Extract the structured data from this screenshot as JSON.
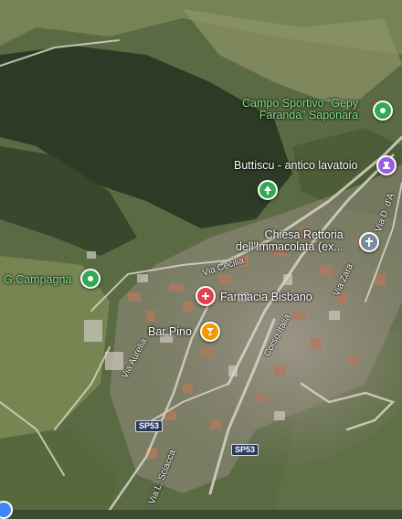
{
  "map": {
    "pois": {
      "campo_sportivo": {
        "line1": "Campo Sportivo “Gepy",
        "line2": "Faranda” Saponara"
      },
      "buttiscu": {
        "label": "Buttiscu - antico lavatoio"
      },
      "chiesa": {
        "line1": "Chiesa Rettoria",
        "line2": "dell'Immacolata (ex..."
      },
      "g_campagna": {
        "label": "G.Campagna"
      },
      "farmacia": {
        "label": "Farmacia Bisbano"
      },
      "bar_pino": {
        "label": "Bar Pino"
      }
    },
    "roads": {
      "via_cecilia": "Via Cecilia",
      "corso_italia": "Corso Italia",
      "via_zara": "Via Zara",
      "via_d_da": "Via D. d'A",
      "via_aurelia": "Via Aurelia",
      "via_l_sciacca": "Via L. Sciacca"
    },
    "shields": {
      "sp53_a": "SP53",
      "sp53_b": "SP53"
    },
    "colors": {
      "park_green": "#34a853",
      "pharmacy_red": "#e0424b",
      "bar_orange": "#f29900",
      "museum_purple": "#9a5ce0",
      "church_gray": "#7b8a99"
    },
    "icons": {
      "campo_sportivo": "sports-pin-icon",
      "buttiscu": "landmark-icon",
      "chiesa": "cross-icon",
      "farmacia": "pharmacy-icon",
      "bar_pino": "cocktail-icon",
      "park": "tree-icon",
      "g_campagna": "pin-icon"
    }
  }
}
